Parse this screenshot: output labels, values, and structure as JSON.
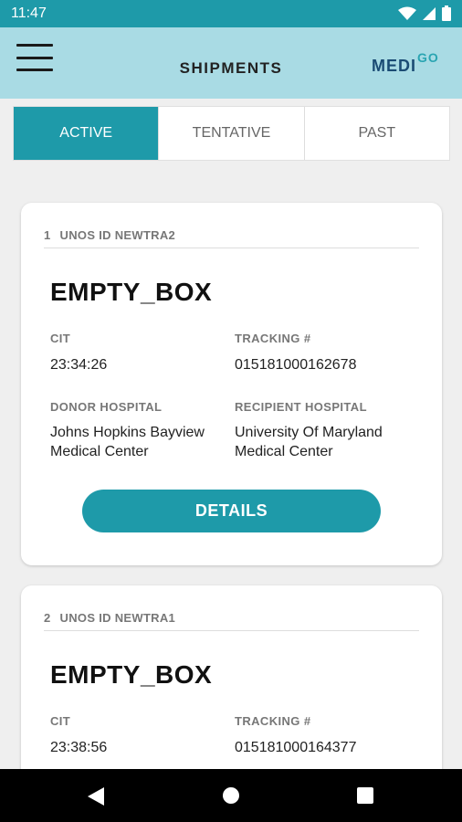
{
  "status_bar": {
    "time": "11:47"
  },
  "app_bar": {
    "title": "SHIPMENTS",
    "logo_medi": "MEDI",
    "logo_go": "GO"
  },
  "tabs": [
    {
      "label": "ACTIVE",
      "selected": true
    },
    {
      "label": "TENTATIVE",
      "selected": false
    },
    {
      "label": "PAST",
      "selected": false
    }
  ],
  "shipments": [
    {
      "index": "1",
      "unos_id": "UNOS ID NEWTRA2",
      "name": "EMPTY_BOX",
      "cit_label": "CIT",
      "cit": "23:34:26",
      "tracking_label": "TRACKING #",
      "tracking": "015181000162678",
      "donor_label": "DONOR HOSPITAL",
      "donor": "Johns Hopkins Bayview Medical Center",
      "recipient_label": "RECIPIENT HOSPITAL",
      "recipient": "University Of Maryland Medical Center",
      "details_label": "DETAILS"
    },
    {
      "index": "2",
      "unos_id": "UNOS ID NEWTRA1",
      "name": "EMPTY_BOX",
      "cit_label": "CIT",
      "cit": "23:38:56",
      "tracking_label": "TRACKING #",
      "tracking": "015181000164377"
    }
  ],
  "colors": {
    "accent": "#1e9aa9",
    "app_bar": "#a9dbe4",
    "logo_dark": "#1a4b74"
  },
  "icons": {
    "wifi": "wifi-icon",
    "signal": "signal-icon",
    "battery": "battery-icon",
    "menu": "menu-icon",
    "back": "back-icon",
    "home": "home-icon",
    "recents": "recents-icon"
  }
}
